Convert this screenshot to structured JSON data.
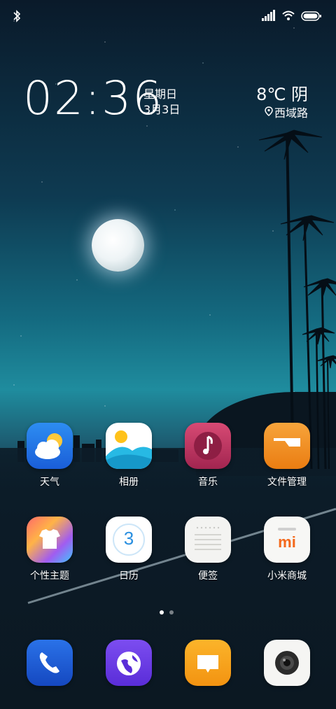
{
  "status": {
    "bluetooth_icon": "bluetooth-icon",
    "signal_icon": "cell-signal-icon",
    "wifi_icon": "wifi-icon",
    "battery_icon": "battery-icon"
  },
  "clock": {
    "time": "02:36",
    "weekday": "星期日",
    "date": "3月3日"
  },
  "weather": {
    "temp_condition": "8℃ 阴",
    "location": "西域路"
  },
  "apps_row1": [
    {
      "label": "天气",
      "icon": "weather-icon"
    },
    {
      "label": "相册",
      "icon": "gallery-icon"
    },
    {
      "label": "音乐",
      "icon": "music-icon"
    },
    {
      "label": "文件管理",
      "icon": "folder-icon"
    }
  ],
  "apps_row2": [
    {
      "label": "个性主题",
      "icon": "theme-icon"
    },
    {
      "label": "日历",
      "icon": "calendar-icon",
      "day": "3"
    },
    {
      "label": "便签",
      "icon": "notes-icon"
    },
    {
      "label": "小米商城",
      "icon": "mi-store-icon",
      "mark": "mi"
    }
  ],
  "dock": [
    {
      "icon": "phone-icon"
    },
    {
      "icon": "browser-icon"
    },
    {
      "icon": "messages-icon"
    },
    {
      "icon": "camera-icon"
    }
  ],
  "pager": {
    "pages": 2,
    "current": 1
  },
  "colors": {
    "weather_bg": "#1f6fe0",
    "music_bg": "#c2375f",
    "files_bg": "#f08c1e",
    "phone_bg": "#1a5fd6",
    "browser_bg": "#6a3ee6",
    "messages_bg": "#f6a21a"
  }
}
